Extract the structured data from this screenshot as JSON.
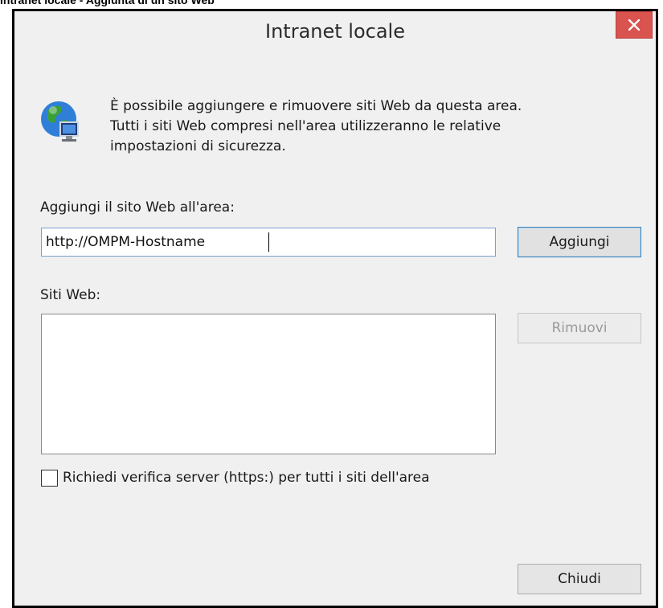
{
  "caption": "Intranet locale - Aggiunta di un sito Web",
  "window": {
    "title": "Intranet locale",
    "close_label": "Chiudi finestra"
  },
  "intro": {
    "line1": "È possibile aggiungere e rimuovere siti Web da questa area.",
    "line2": "Tutti i siti Web compresi nell'area utilizzeranno le relative",
    "line3": "impostazioni di sicurezza."
  },
  "add_site": {
    "label": "Aggiungi il sito Web all'area:",
    "value": "http://OMPM-Hostname",
    "button": "Aggiungi"
  },
  "sites": {
    "label": "Siti Web:",
    "items": [],
    "remove_button": "Rimuovi"
  },
  "https_check": {
    "label": "Richiedi verifica server (https:) per tutti i siti dell'area",
    "checked": false
  },
  "footer": {
    "close_button": "Chiudi"
  },
  "colors": {
    "close_bg": "#d9534f",
    "input_border": "#7a9fd0"
  },
  "icons": {
    "header": "globe-computer-icon",
    "close": "close-icon"
  }
}
